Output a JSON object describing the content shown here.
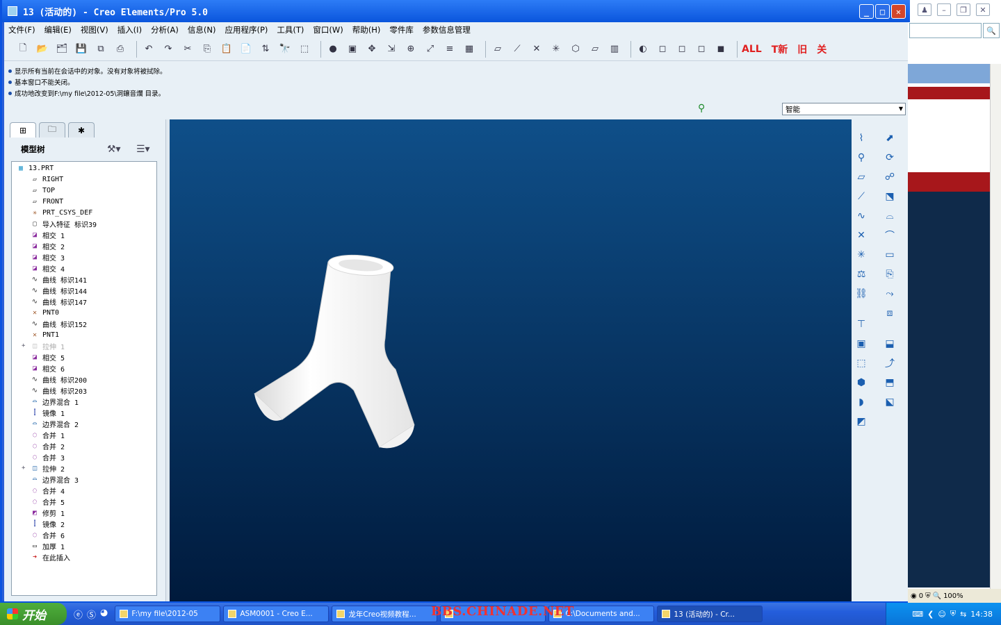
{
  "window": {
    "title": "13 (活动的) - Creo Elements/Pro 5.0",
    "buttons": {
      "minimize": "_",
      "maximize": "□",
      "close": "✕"
    }
  },
  "menu": [
    "文件(F)",
    "编辑(E)",
    "视图(V)",
    "插入(I)",
    "分析(A)",
    "信息(N)",
    "应用程序(P)",
    "工具(T)",
    "窗口(W)",
    "帮助(H)",
    "零件库",
    "参数信息管理"
  ],
  "toolbar_text": {
    "all": "ALL",
    "new": "T新",
    "old": "旧",
    "close": "关"
  },
  "messages": [
    "显示所有当前在会话中的对象。没有对象将被拭除。",
    "基本窗口不能关闭。",
    "成功地改变到F:\\my file\\2012-05\\洞鑲音爛 目录。"
  ],
  "selection_filter": "智能",
  "model_tree": {
    "title": "模型树",
    "items": [
      {
        "label": "13.PRT",
        "icon": "part-icon",
        "indent": 0
      },
      {
        "label": "RIGHT",
        "icon": "datum-plane-icon",
        "indent": 1
      },
      {
        "label": "TOP",
        "icon": "datum-plane-icon",
        "indent": 1
      },
      {
        "label": "FRONT",
        "icon": "datum-plane-icon",
        "indent": 1
      },
      {
        "label": "PRT_CSYS_DEF",
        "icon": "csys-icon",
        "indent": 1
      },
      {
        "label": "导入特征 标识39",
        "icon": "import-feature-icon",
        "indent": 1
      },
      {
        "label": "相交 1",
        "icon": "intersect-icon",
        "indent": 1
      },
      {
        "label": "相交 2",
        "icon": "intersect-icon",
        "indent": 1
      },
      {
        "label": "相交 3",
        "icon": "intersect-icon",
        "indent": 1
      },
      {
        "label": "相交 4",
        "icon": "intersect-icon",
        "indent": 1
      },
      {
        "label": "曲线 标识141",
        "icon": "curve-icon",
        "indent": 1
      },
      {
        "label": "曲线 标识144",
        "icon": "curve-icon",
        "indent": 1
      },
      {
        "label": "曲线 标识147",
        "icon": "curve-icon",
        "indent": 1
      },
      {
        "label": "PNT0",
        "icon": "datum-point-icon",
        "indent": 1
      },
      {
        "label": "曲线 标识152",
        "icon": "curve-icon",
        "indent": 1
      },
      {
        "label": "PNT1",
        "icon": "datum-point-icon",
        "indent": 1
      },
      {
        "label": "拉伸 1",
        "icon": "extrude-icon",
        "indent": 1,
        "dim": true,
        "expandable": true
      },
      {
        "label": "相交 5",
        "icon": "intersect-icon",
        "indent": 1
      },
      {
        "label": "相交 6",
        "icon": "intersect-icon",
        "indent": 1
      },
      {
        "label": "曲线 标识200",
        "icon": "curve-icon",
        "indent": 1
      },
      {
        "label": "曲线 标识203",
        "icon": "curve-icon",
        "indent": 1
      },
      {
        "label": "边界混合 1",
        "icon": "boundary-blend-icon",
        "indent": 1
      },
      {
        "label": "镜像 1",
        "icon": "mirror-icon",
        "indent": 1
      },
      {
        "label": "边界混合 2",
        "icon": "boundary-blend-icon",
        "indent": 1
      },
      {
        "label": "合并 1",
        "icon": "merge-icon",
        "indent": 1
      },
      {
        "label": "合并 2",
        "icon": "merge-icon",
        "indent": 1
      },
      {
        "label": "合并 3",
        "icon": "merge-icon",
        "indent": 1
      },
      {
        "label": "拉伸 2",
        "icon": "extrude-icon",
        "indent": 1,
        "expandable": true
      },
      {
        "label": "边界混合 3",
        "icon": "boundary-blend-icon",
        "indent": 1
      },
      {
        "label": "合并 4",
        "icon": "merge-icon",
        "indent": 1
      },
      {
        "label": "合并 5",
        "icon": "merge-icon",
        "indent": 1
      },
      {
        "label": "修剪 1",
        "icon": "trim-icon",
        "indent": 1
      },
      {
        "label": "镜像 2",
        "icon": "mirror-icon",
        "indent": 1
      },
      {
        "label": "合并 6",
        "icon": "merge-icon",
        "indent": 1
      },
      {
        "label": "加厚 1",
        "icon": "thicken-icon",
        "indent": 1
      },
      {
        "label": "在此插入",
        "icon": "insert-here-icon",
        "indent": 1
      }
    ]
  },
  "taskbar": {
    "start": "开始",
    "tasks": [
      {
        "label": "F:\\my file\\2012-05",
        "active": false
      },
      {
        "label": "ASM0001 - Creo E...",
        "active": false
      },
      {
        "label": "龙年Creo视频教程...",
        "active": false
      },
      {
        "label": "",
        "active": false
      },
      {
        "label": "C:\\Documents and...",
        "active": false
      },
      {
        "label": "13 (活动的) - Cr...",
        "active": true
      }
    ],
    "clock": "14:38"
  },
  "watermark": "BBS.CHINADE.NET",
  "background_window": {
    "status_count": "0",
    "zoom": "100%"
  }
}
